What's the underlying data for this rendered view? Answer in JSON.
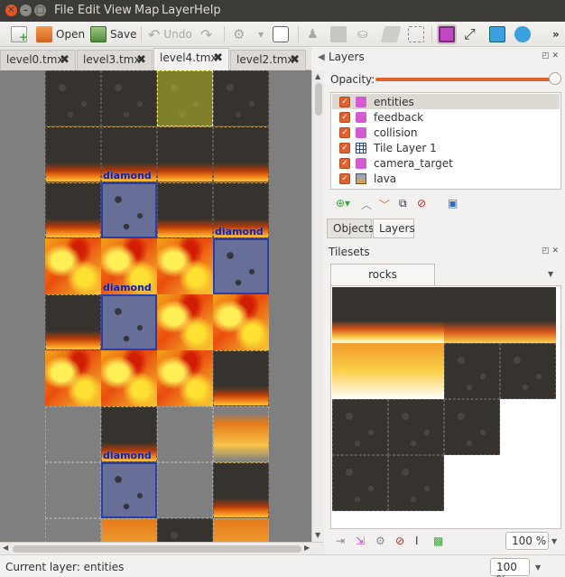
{
  "menubar": {
    "items": [
      "File",
      "Edit",
      "View",
      "Map",
      "Layer",
      "Help"
    ]
  },
  "toolbar": {
    "new_label": "",
    "open_label": "Open",
    "save_label": "Save",
    "undo_label": "Undo",
    "overflow": "»"
  },
  "tabs": [
    {
      "label": "level0.tmx",
      "active": false
    },
    {
      "label": "level3.tmx",
      "active": false
    },
    {
      "label": "level4.tmx",
      "active": true
    },
    {
      "label": "level2.tmx",
      "active": false
    }
  ],
  "map": {
    "object_labels": [
      "diamond",
      "diamond",
      "diamond",
      "diamond"
    ]
  },
  "layers_panel": {
    "title": "Layers",
    "opacity_label": "Opacity:",
    "opacity": 1.0,
    "layers": [
      {
        "name": "entities",
        "type": "object-layer-icon",
        "visible": true,
        "selected": true
      },
      {
        "name": "feedback",
        "type": "object-layer-icon",
        "visible": true,
        "selected": false
      },
      {
        "name": "collision",
        "type": "object-layer-icon",
        "visible": true,
        "selected": false
      },
      {
        "name": "Tile Layer 1",
        "type": "tile-layer-icon",
        "visible": true,
        "selected": false
      },
      {
        "name": "camera_target",
        "type": "object-layer-icon",
        "visible": true,
        "selected": false
      },
      {
        "name": "lava",
        "type": "image-layer-icon",
        "visible": true,
        "selected": false
      }
    ]
  },
  "panel_tabs": [
    {
      "label": "Objects",
      "active": false
    },
    {
      "label": "Layers",
      "active": true
    }
  ],
  "tilesets_panel": {
    "title": "Tilesets",
    "tab": "rocks",
    "zoom": "100 %"
  },
  "status": {
    "current_layer": "Current layer: entities",
    "zoom": "100 %"
  },
  "colors": {
    "menubar_bg": "#3c3b37",
    "accent_orange": "#e0612c",
    "selection_blue": "#2a3da8"
  }
}
